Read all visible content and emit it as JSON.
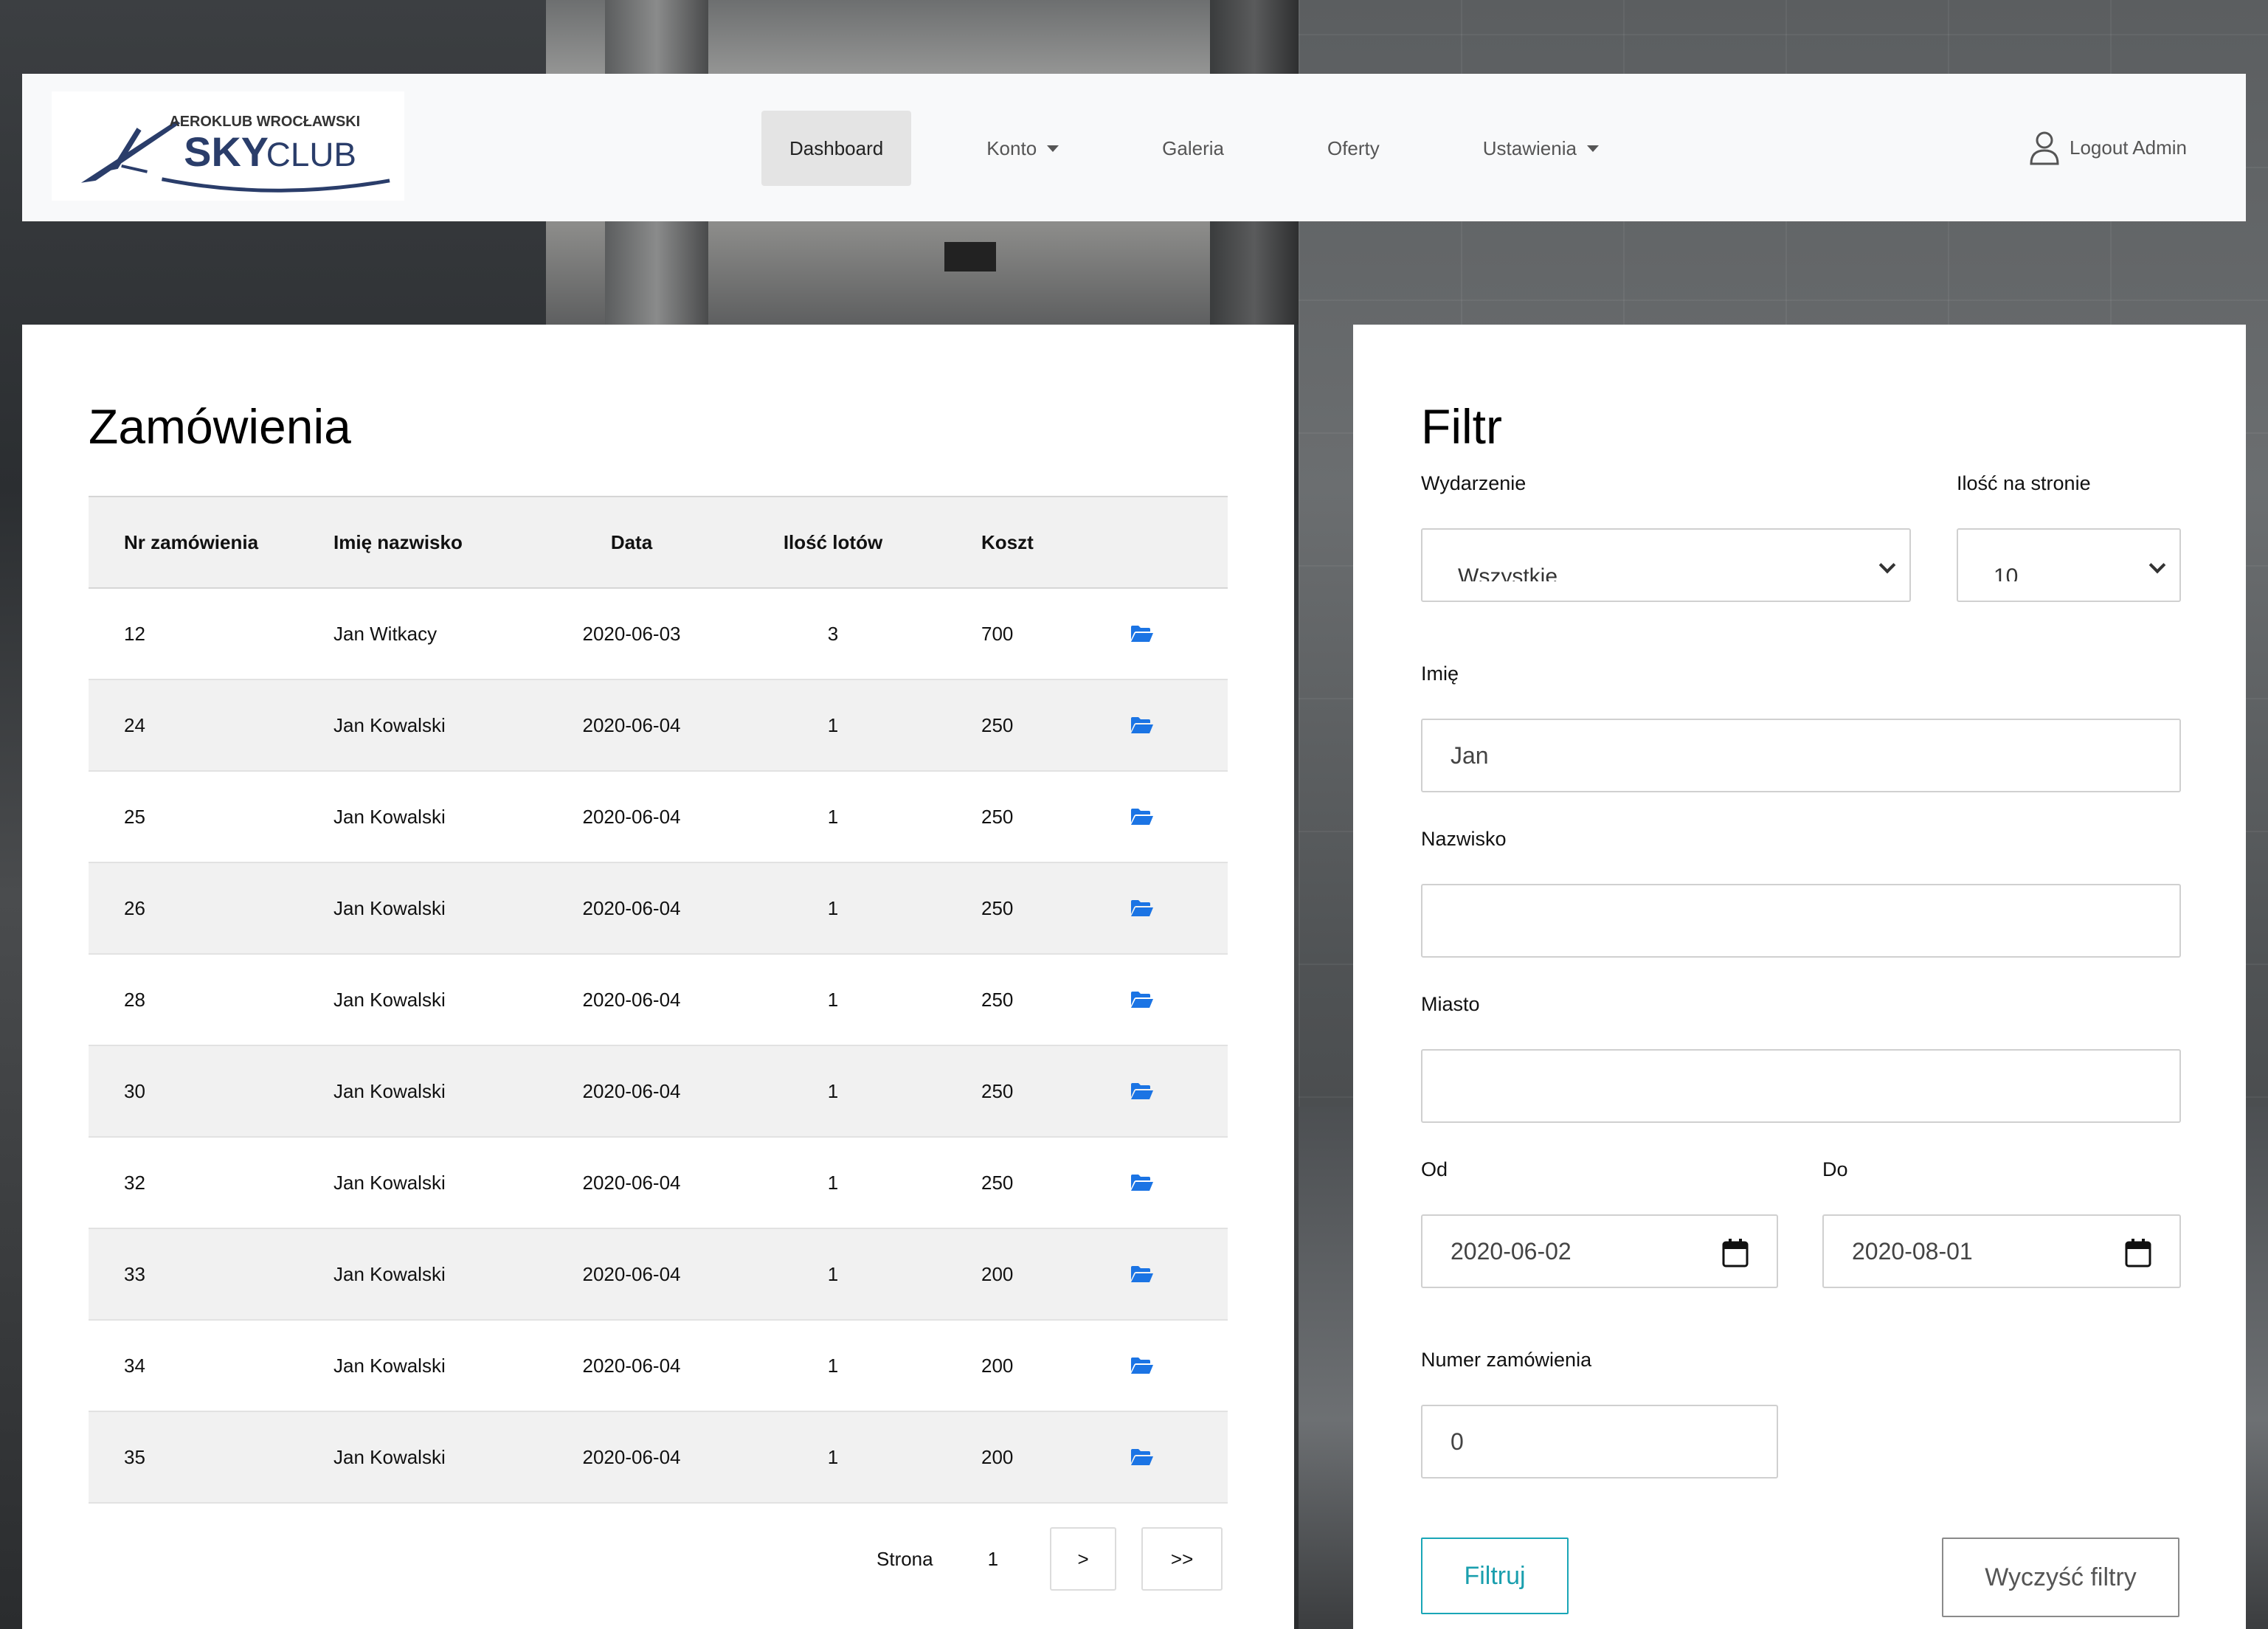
{
  "logo": {
    "line1": "AEROKLUB WROCŁAWSKI",
    "sky": "SKY",
    "club": "CLUB"
  },
  "nav": {
    "items": [
      {
        "label": "Dashboard",
        "active": true,
        "dropdown": false
      },
      {
        "label": "Konto",
        "active": false,
        "dropdown": true
      },
      {
        "label": "Galeria",
        "active": false,
        "dropdown": false
      },
      {
        "label": "Oferty",
        "active": false,
        "dropdown": false
      },
      {
        "label": "Ustawienia",
        "active": false,
        "dropdown": true
      }
    ],
    "logout_label": "Logout Admin"
  },
  "orders": {
    "title": "Zamówienia",
    "columns": [
      "Nr zamówienia",
      "Imię nazwisko",
      "Data",
      "Ilość lotów",
      "Koszt"
    ],
    "rows": [
      [
        "12",
        "Jan Witkacy",
        "2020-06-03",
        "3",
        "700"
      ],
      [
        "24",
        "Jan Kowalski",
        "2020-06-04",
        "1",
        "250"
      ],
      [
        "25",
        "Jan Kowalski",
        "2020-06-04",
        "1",
        "250"
      ],
      [
        "26",
        "Jan Kowalski",
        "2020-06-04",
        "1",
        "250"
      ],
      [
        "28",
        "Jan Kowalski",
        "2020-06-04",
        "1",
        "250"
      ],
      [
        "30",
        "Jan Kowalski",
        "2020-06-04",
        "1",
        "250"
      ],
      [
        "32",
        "Jan Kowalski",
        "2020-06-04",
        "1",
        "250"
      ],
      [
        "33",
        "Jan Kowalski",
        "2020-06-04",
        "1",
        "200"
      ],
      [
        "34",
        "Jan Kowalski",
        "2020-06-04",
        "1",
        "200"
      ],
      [
        "35",
        "Jan Kowalski",
        "2020-06-04",
        "1",
        "200"
      ]
    ],
    "pager": {
      "label": "Strona",
      "page": "1",
      "next": ">",
      "last": ">>"
    }
  },
  "filter": {
    "title": "Filtr",
    "event_label": "Wydarzenie",
    "event_value": "Wszystkie",
    "per_page_label": "Ilość na stronie",
    "per_page_value": "10",
    "first_name_label": "Imię",
    "first_name_value": "Jan",
    "last_name_label": "Nazwisko",
    "last_name_value": "",
    "city_label": "Miasto",
    "city_value": "",
    "from_label": "Od",
    "from_value": "2020-06-02",
    "to_label": "Do",
    "to_value": "2020-08-01",
    "order_number_label": "Numer zamówienia",
    "order_number_value": "0",
    "submit_label": "Filtruj",
    "clear_label": "Wyczyść filtry"
  },
  "colors": {
    "accent": "#1aa6b7",
    "icon_blue": "#1b74e4",
    "navy": "#2a3d6a"
  }
}
